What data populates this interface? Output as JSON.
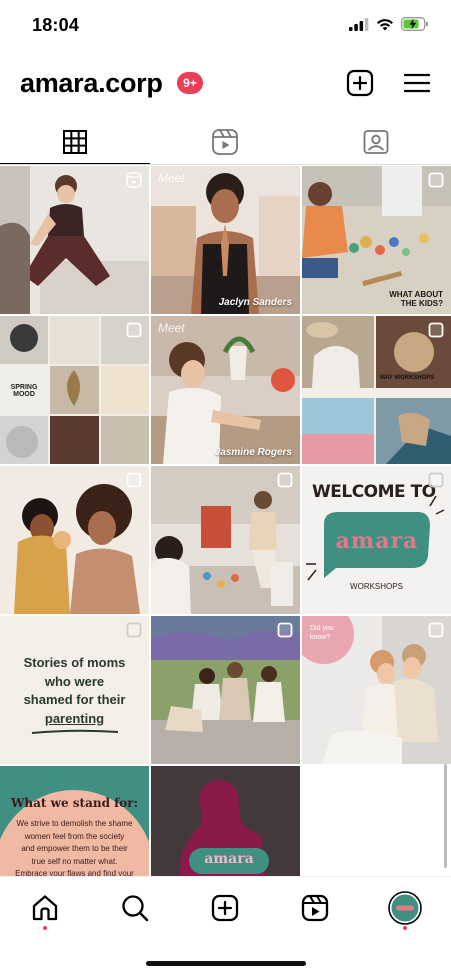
{
  "status": {
    "time": "18:04"
  },
  "profile": {
    "username": "amara.corp",
    "notifications": "9+"
  },
  "tabs": [
    {
      "icon": "grid-icon",
      "active": true
    },
    {
      "icon": "reels-icon",
      "active": false
    },
    {
      "icon": "tagged-icon",
      "active": false
    }
  ],
  "posts": [
    {
      "type": "reel"
    },
    {
      "meet": "Meet",
      "caption": "Jaclyn Sanders",
      "type": "none"
    },
    {
      "caption": "WHAT ABOUT THE KIDS?",
      "type": "carousel"
    },
    {
      "label": "SPRING MOOD",
      "type": "carousel"
    },
    {
      "meet": "Meet",
      "caption": "Jasmine Rogers",
      "type": "none"
    },
    {
      "caption": "MAY WORKSHOPS",
      "type": "carousel"
    },
    {
      "type": "carousel"
    },
    {
      "type": "carousel"
    },
    {
      "headline": "WELCOME TO",
      "brand": "amara",
      "sub": "WORKSHOPS",
      "type": "carousel"
    },
    {
      "headline_lines": [
        "Stories of moms",
        "who were",
        "shamed for their",
        "parenting"
      ],
      "type": "carousel"
    },
    {
      "type": "carousel"
    },
    {
      "corner": "Did you know?",
      "type": "carousel"
    },
    {
      "headline": "What we stand for:",
      "body_lines": [
        "We strive to demolish the shame",
        "women feel from the society",
        "and empower them to be their",
        "true self no matter what.",
        "Embrace your flaws and find your"
      ],
      "type": "none"
    },
    {
      "brand": "amara",
      "type": "none"
    }
  ],
  "nav": [
    {
      "icon": "home-icon",
      "badge": true
    },
    {
      "icon": "search-icon",
      "badge": false
    },
    {
      "icon": "create-icon",
      "badge": false
    },
    {
      "icon": "reels-icon",
      "badge": false
    },
    {
      "icon": "profile-avatar",
      "badge": true
    }
  ],
  "colors": {
    "accent": "#ed3e57",
    "teal": "#3f8f83",
    "brand_pink": "#e07a8b",
    "maroon": "#8a1a4a"
  }
}
